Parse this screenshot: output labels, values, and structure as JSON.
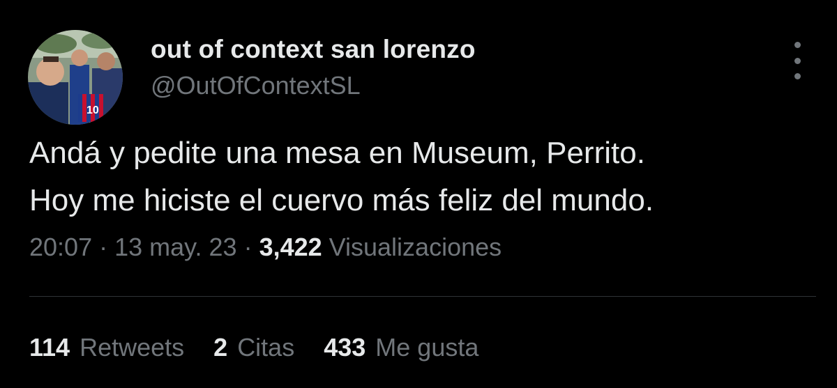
{
  "author": {
    "display_name": "out of context san lorenzo",
    "handle": "@OutOfContextSL",
    "avatar_icon": "profile-photo"
  },
  "tweet": {
    "lines": [
      "Andá y pedite una mesa en Museum, Perrito.",
      "Hoy me hiciste el cuervo más feliz del mundo."
    ],
    "time": "20:07",
    "date": "13 may. 23",
    "separator": "·",
    "views_count": "3,422",
    "views_label": "Visualizaciones"
  },
  "stats": {
    "retweets_count": "114",
    "retweets_label": "Retweets",
    "quotes_count": "2",
    "quotes_label": "Citas",
    "likes_count": "433",
    "likes_label": "Me gusta"
  },
  "colors": {
    "background": "#000000",
    "primary_text": "#e7e9ea",
    "secondary_text": "#71767b",
    "divider": "#2f3336"
  },
  "icons": {
    "more": "more-options-icon"
  }
}
